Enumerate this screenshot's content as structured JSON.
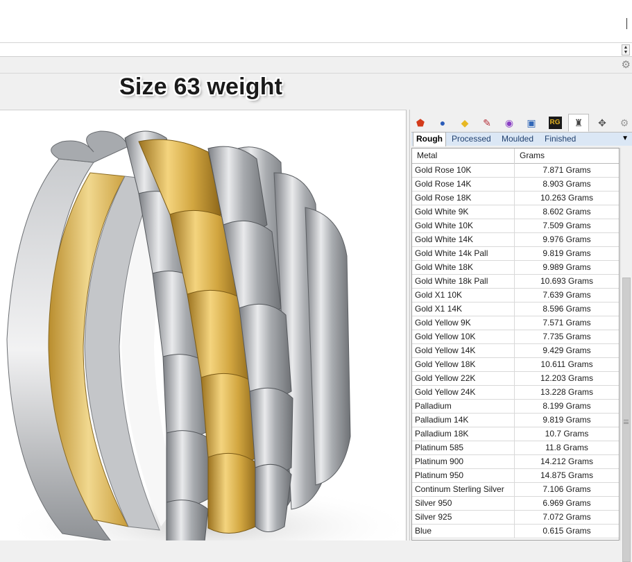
{
  "overlay": {
    "title": "Size 63 weight"
  },
  "panel": {
    "tabs": [
      {
        "icon": "red-shield-icon",
        "glyph": "⬟",
        "color": "#d33a1a"
      },
      {
        "icon": "blue-sphere-icon",
        "glyph": "●",
        "color": "#2b5cb8"
      },
      {
        "icon": "gold-nugget-icon",
        "glyph": "◆",
        "color": "#e7b824"
      },
      {
        "icon": "pen-tool-icon",
        "glyph": "✎",
        "color": "#b6313a"
      },
      {
        "icon": "color-wheel-icon",
        "glyph": "◉",
        "color": "#8a3fc4"
      },
      {
        "icon": "picture-icon",
        "glyph": "▣",
        "color": "#3469b8"
      },
      {
        "icon": "rg-logo-icon",
        "glyph": "RG",
        "color": "#e0b020"
      },
      {
        "icon": "ring-weight-icon",
        "glyph": "♜",
        "color": "#444444"
      },
      {
        "icon": "move-arrows-icon",
        "glyph": "✥",
        "color": "#555555"
      },
      {
        "icon": "gear-icon",
        "glyph": "⚙",
        "color": "#9a9a9a"
      }
    ],
    "subtabs": [
      "Rough",
      "Processed",
      "Moulded",
      "Finished"
    ],
    "active_subtab": "Rough",
    "table": {
      "headers": [
        "Metal",
        "Grams"
      ],
      "rows": [
        {
          "metal": "Gold Rose 10K",
          "grams": "7.871 Grams"
        },
        {
          "metal": "Gold Rose 14K",
          "grams": "8.903 Grams"
        },
        {
          "metal": "Gold Rose 18K",
          "grams": "10.263 Grams"
        },
        {
          "metal": "Gold White 9K",
          "grams": "8.602 Grams"
        },
        {
          "metal": "Gold White 10K",
          "grams": "7.509 Grams"
        },
        {
          "metal": "Gold White 14K",
          "grams": "9.976 Grams"
        },
        {
          "metal": "Gold White 14k Pall",
          "grams": "9.819 Grams"
        },
        {
          "metal": "Gold White 18K",
          "grams": "9.989 Grams"
        },
        {
          "metal": "Gold White 18k Pall",
          "grams": "10.693 Grams"
        },
        {
          "metal": "Gold X1 10K",
          "grams": "7.639 Grams"
        },
        {
          "metal": "Gold X1 14K",
          "grams": "8.596 Grams"
        },
        {
          "metal": "Gold Yellow 9K",
          "grams": "7.571 Grams"
        },
        {
          "metal": "Gold Yellow 10K",
          "grams": "7.735 Grams"
        },
        {
          "metal": "Gold Yellow 14K",
          "grams": "9.429 Grams"
        },
        {
          "metal": "Gold Yellow 18K",
          "grams": "10.611 Grams"
        },
        {
          "metal": "Gold Yellow 22K",
          "grams": "12.203 Grams"
        },
        {
          "metal": "Gold Yellow 24K",
          "grams": "13.228 Grams"
        },
        {
          "metal": "Palladium",
          "grams": "8.199 Grams"
        },
        {
          "metal": "Palladium 14K",
          "grams": "9.819 Grams"
        },
        {
          "metal": "Palladium 18K",
          "grams": "10.7 Grams"
        },
        {
          "metal": "Platinum 585",
          "grams": "11.8 Grams"
        },
        {
          "metal": "Platinum 900",
          "grams": "14.212 Grams"
        },
        {
          "metal": "Platinum 950",
          "grams": "14.875 Grams"
        },
        {
          "metal": "Continum Sterling Silver",
          "grams": "7.106 Grams"
        },
        {
          "metal": "Silver 950",
          "grams": "6.969 Grams"
        },
        {
          "metal": "Silver 925",
          "grams": "7.072 Grams"
        },
        {
          "metal": "Blue",
          "grams": "0.615 Grams"
        }
      ]
    }
  },
  "colors": {
    "gold": "#d9b04a",
    "silver": "#b9bcc0",
    "subtab_bg": "#dbe7f5"
  }
}
